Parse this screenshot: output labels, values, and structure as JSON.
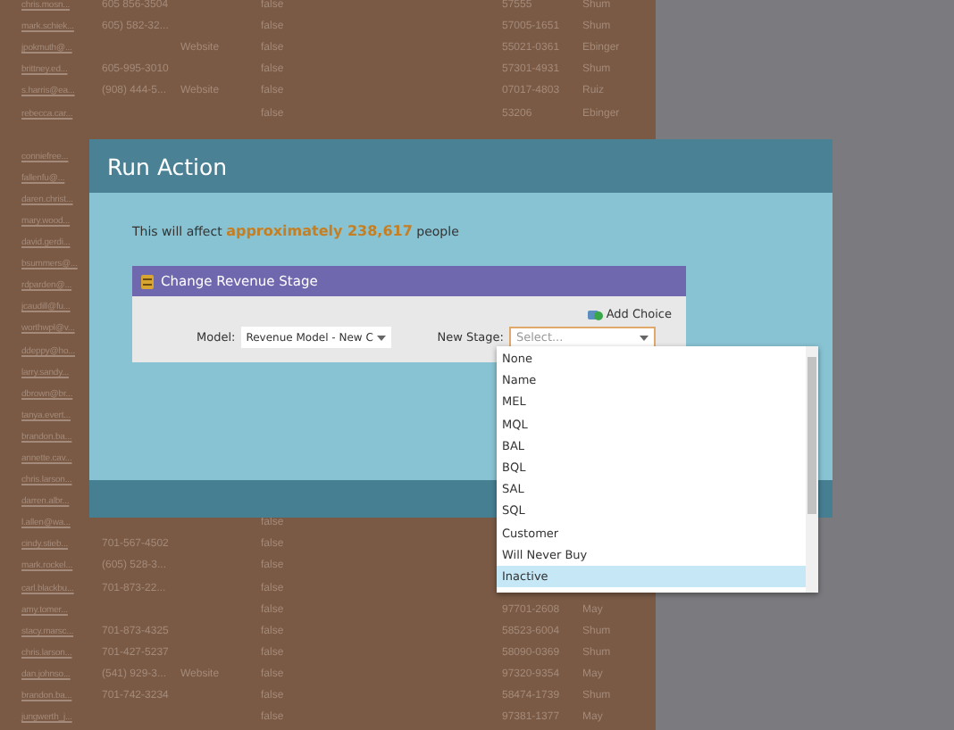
{
  "table": {
    "rows": [
      {
        "email": "chris.mosn...",
        "phone": "605 856-3504",
        "flag": "false",
        "zip": "57555",
        "owner": "Shum"
      },
      {
        "email": "mark.schiek...",
        "phone": "605) 582-32...",
        "flag": "false",
        "zip": "57005-1651",
        "owner": "Shum"
      },
      {
        "email": "jpokmuth@...",
        "source": "Website",
        "flag": "false",
        "zip": "55021-0361",
        "owner": "Ebinger"
      },
      {
        "email": "brittney.ed...",
        "phone": "605-995-3010",
        "flag": "false",
        "zip": "57301-4931",
        "owner": "Shum"
      },
      {
        "email": "s.harris@ea...",
        "phone": "(908) 444-5...",
        "source": "Website",
        "flag": "false",
        "zip": "07017-4803",
        "owner": "Ruiz"
      },
      {
        "email": "rebecca.car...",
        "flag": "false",
        "zip": "53206",
        "owner": "Ebinger"
      },
      {},
      {
        "email": "conniefree..."
      },
      {
        "email": "fallenfu@..."
      },
      {
        "email": "daren.christ..."
      },
      {
        "email": "mary.wood..."
      },
      {
        "email": "david.gerdi..."
      },
      {
        "email": "bsummers@..."
      },
      {
        "email": "rdparden@..."
      },
      {
        "email": "jcaudill@fu..."
      },
      {
        "email": "worthwpl@v..."
      },
      {
        "email": "ddeppy@ho..."
      },
      {
        "email": "larry.sandy..."
      },
      {
        "email": "dbrown@br..."
      },
      {
        "email": "tanya.evert..."
      },
      {
        "email": "brandon.ba..."
      },
      {
        "email": "annette.cav..."
      },
      {
        "email": "chris.larson..."
      },
      {
        "email": "darren.albr..."
      },
      {
        "email": "l.allen@wa...",
        "flag": "false"
      },
      {
        "email": "cindy.stieb...",
        "phone": "701-567-4502",
        "flag": "false"
      },
      {
        "email": "mark.rockel...",
        "phone": "(605) 528-3...",
        "flag": "false"
      },
      {
        "email": "carl.blackbu...",
        "phone": "701-873-22...",
        "flag": "false"
      },
      {
        "email": "amy.tomer...",
        "flag": "false",
        "zip": "97701-2608",
        "owner": "May"
      },
      {
        "email": "stacy.marsc...",
        "phone": "701-873-4325",
        "flag": "false",
        "zip": "58523-6004",
        "owner": "Shum"
      },
      {
        "email": "chris.larson...",
        "phone": "701-427-5237",
        "flag": "false",
        "zip": "58090-0369",
        "owner": "Shum"
      },
      {
        "email": "dan.johnso...",
        "phone": "(541) 929-3...",
        "source": "Website",
        "flag": "false",
        "zip": "97320-9354",
        "owner": "May"
      },
      {
        "email": "brandon.ba...",
        "phone": "701-742-3234",
        "flag": "false",
        "zip": "58474-1739",
        "owner": "Shum"
      },
      {
        "email": "jungwerth_j...",
        "flag": "false",
        "zip": "97381-1377",
        "owner": "May"
      }
    ]
  },
  "dialog": {
    "title": "Run Action",
    "message": "This will affect **approximately 238,617** people",
    "panel": {
      "title": "Change Revenue Stage",
      "add_choice": "Add Choice",
      "model": {
        "label": "Model:",
        "value": "Revenue Model - New C"
      },
      "stage": {
        "label": "New Stage:",
        "placeholder": "Select..."
      }
    }
  },
  "dropdown": {
    "options": [
      {
        "label": "None",
        "selected": false
      },
      {
        "label": "Name",
        "selected": false
      },
      {
        "label": "MEL",
        "selected": false
      },
      {
        "label": "MQL",
        "selected": false
      },
      {
        "label": "BAL",
        "selected": false
      },
      {
        "label": "BQL",
        "selected": false
      },
      {
        "label": "SAL",
        "selected": false
      },
      {
        "label": "SQL",
        "selected": false
      },
      {
        "label": "Customer",
        "selected": false
      },
      {
        "label": "Will Never Buy",
        "selected": false
      },
      {
        "label": "Inactive",
        "selected": true
      }
    ]
  }
}
